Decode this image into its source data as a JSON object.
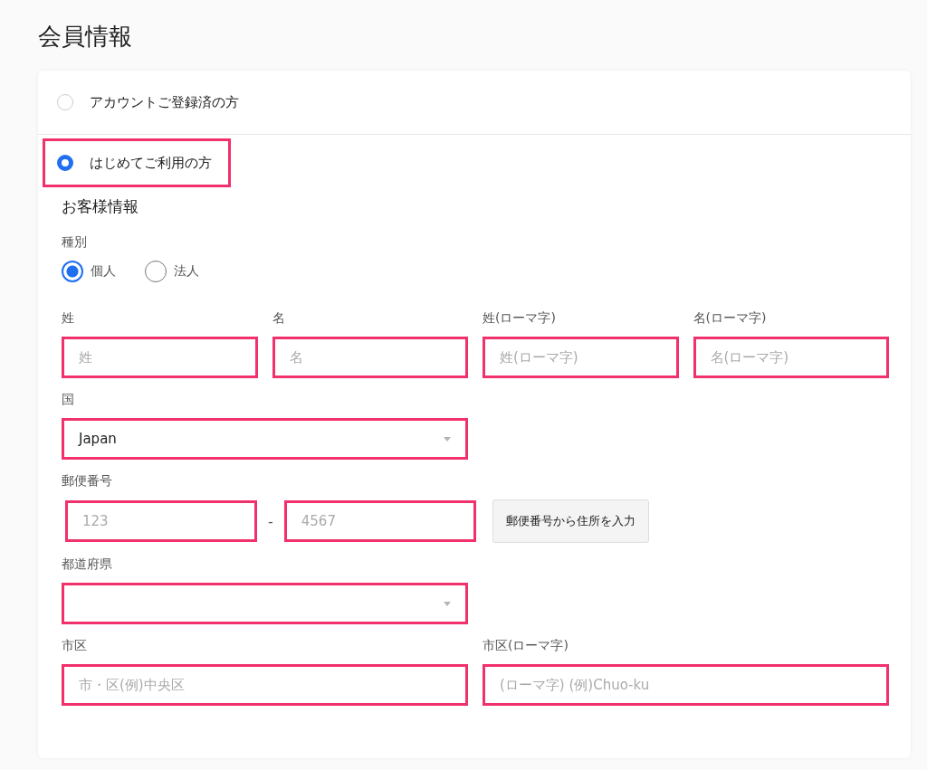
{
  "page_title": "会員情報",
  "account_options": [
    {
      "label": "アカウントご登録済の方",
      "selected": false,
      "highlighted": false
    },
    {
      "label": "はじめてご利用の方",
      "selected": true,
      "highlighted": true
    }
  ],
  "section_title": "お客様情報",
  "customer_type": {
    "label": "種別",
    "options": [
      {
        "label": "個人",
        "selected": true
      },
      {
        "label": "法人",
        "selected": false
      }
    ]
  },
  "rows": [
    {
      "fields": [
        {
          "kind": "text",
          "label": "姓",
          "placeholder": "姓",
          "highlighted": true
        },
        {
          "kind": "text",
          "label": "名",
          "placeholder": "名",
          "highlighted": true
        },
        {
          "kind": "text",
          "label": "姓(ローマ字)",
          "placeholder": "姓(ローマ字)",
          "highlighted": true
        },
        {
          "kind": "text",
          "label": "名(ローマ字)",
          "placeholder": "名(ローマ字)",
          "highlighted": true
        }
      ]
    },
    {
      "fields": [
        {
          "kind": "select",
          "label": "国",
          "value": "Japan",
          "highlighted": true
        }
      ]
    },
    {
      "fields": [
        {
          "kind": "postal",
          "label": "郵便番号",
          "parts": [
            {
              "placeholder": "123",
              "highlighted": true
            },
            {
              "placeholder": "4567",
              "highlighted": true
            }
          ],
          "separator": "-",
          "button": "郵便番号から住所を入力"
        }
      ]
    },
    {
      "fields": [
        {
          "kind": "select",
          "label": "都道府県",
          "highlighted": true
        }
      ]
    },
    {
      "fields": [
        {
          "kind": "text",
          "label": "市区",
          "placeholder": "市・区(例)中央区",
          "highlighted": true
        },
        {
          "kind": "text",
          "label": "市区(ローマ字)",
          "placeholder": "(ローマ字) (例)Chuo-ku",
          "highlighted": true
        }
      ]
    }
  ]
}
